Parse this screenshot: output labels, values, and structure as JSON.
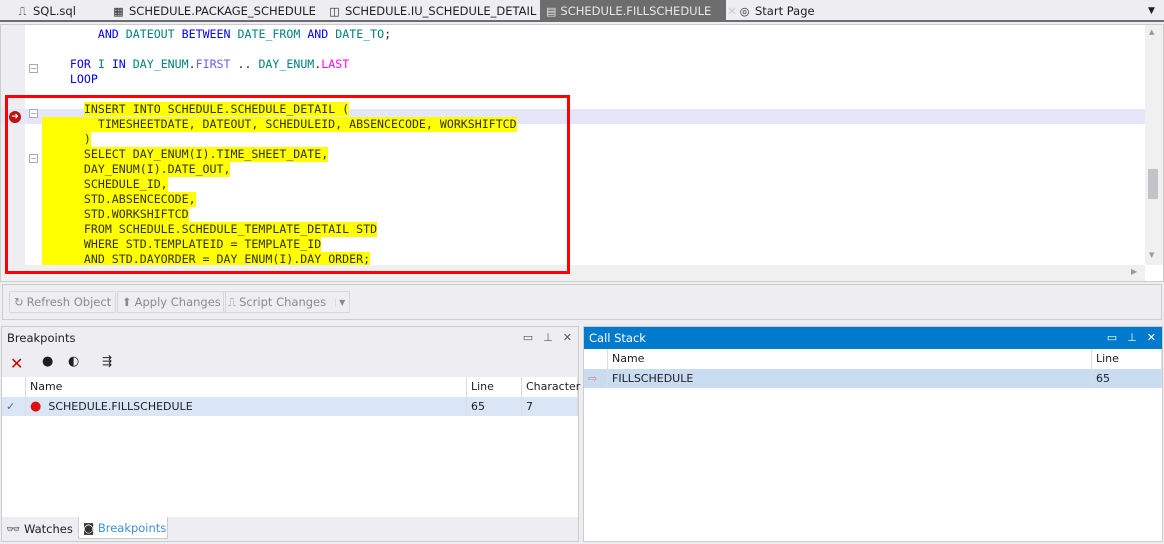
{
  "tabs": [
    {
      "label": "SQL.sql",
      "icon": "sql-file-icon"
    },
    {
      "label": "SCHEDULE.PACKAGE_SCHEDULE",
      "icon": "package-icon"
    },
    {
      "label": "SCHEDULE.IU_SCHEDULE_DETAIL",
      "icon": "trigger-icon"
    },
    {
      "label": "SCHEDULE.FILLSCHEDULE",
      "icon": "procedure-icon",
      "active": true
    },
    {
      "label": "Start Page",
      "icon": "start-page-icon"
    }
  ],
  "editor": {
    "lines": [
      "AND DATEOUT BETWEEN DATE_FROM AND DATE_TO;",
      "FOR I IN DAY_ENUM.FIRST .. DAY_ENUM.LAST",
      "LOOP",
      "INSERT INTO SCHEDULE.SCHEDULE_DETAIL (",
      "TIMESHEETDATE, DATEOUT, SCHEDULEID, ABSENCECODE, WORKSHIFTCD",
      ")",
      "SELECT DAY_ENUM(I).TIME_SHEET_DATE,",
      "DAY_ENUM(I).DATE_OUT,",
      "SCHEDULE_ID,",
      "STD.ABSENCECODE,",
      "STD.WORKSHIFTCD",
      "FROM SCHEDULE.SCHEDULE_TEMPLATE_DETAIL STD",
      "WHERE STD.TEMPLATEID = TEMPLATE_ID",
      "AND STD.DAYORDER = DAY_ENUM(I).DAY_ORDER;"
    ],
    "highlight_color": "#ffff00",
    "annotation_color": "#ff0000"
  },
  "toolbar": {
    "refresh": "Refresh Object",
    "apply": "Apply Changes",
    "script": "Script Changes"
  },
  "breakpoints": {
    "title": "Breakpoints",
    "columns": [
      "Name",
      "Line",
      "Character"
    ],
    "rows": [
      {
        "checked": true,
        "name": "SCHEDULE.FILLSCHEDULE",
        "line": "65",
        "character": "7"
      }
    ]
  },
  "callstack": {
    "title": "Call Stack",
    "columns": [
      "Name",
      "Line"
    ],
    "rows": [
      {
        "name": "FILLSCHEDULE",
        "line": "65"
      }
    ],
    "accent": "#007acc"
  },
  "bottom_tabs": [
    {
      "label": "Watches"
    },
    {
      "label": "Breakpoints",
      "active": true
    }
  ]
}
